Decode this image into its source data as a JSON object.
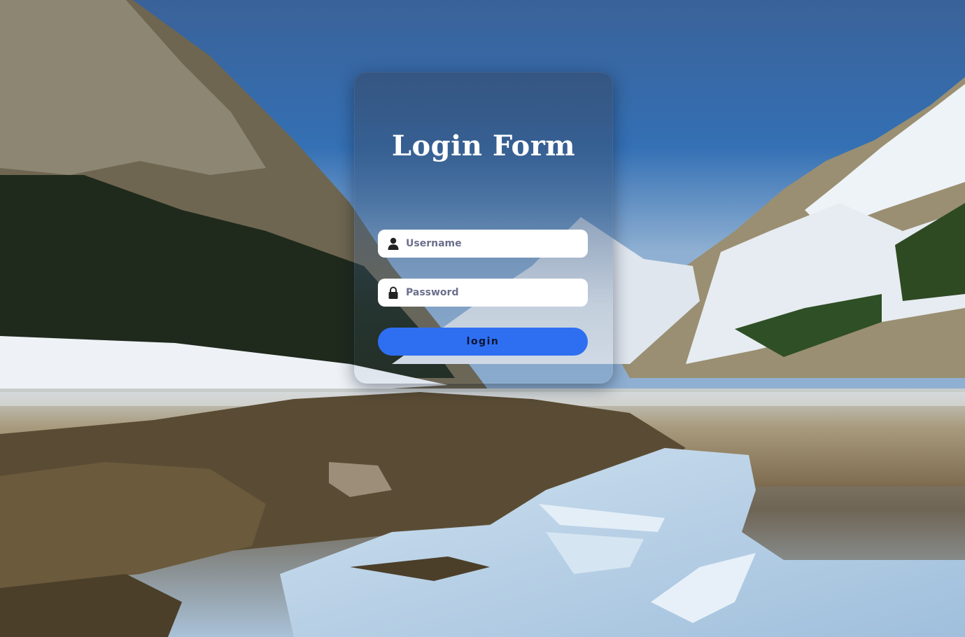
{
  "login_form": {
    "title": "Login Form",
    "username": {
      "placeholder": "Username",
      "value": "",
      "icon": "user-icon"
    },
    "password": {
      "placeholder": "Password",
      "value": "",
      "icon": "lock-icon"
    },
    "submit_label": "login"
  },
  "colors": {
    "button": "#2e6ff2",
    "field_background": "#ffffff",
    "title": "#ffffff"
  },
  "background": {
    "subject": "alpine-lake-landscape"
  }
}
